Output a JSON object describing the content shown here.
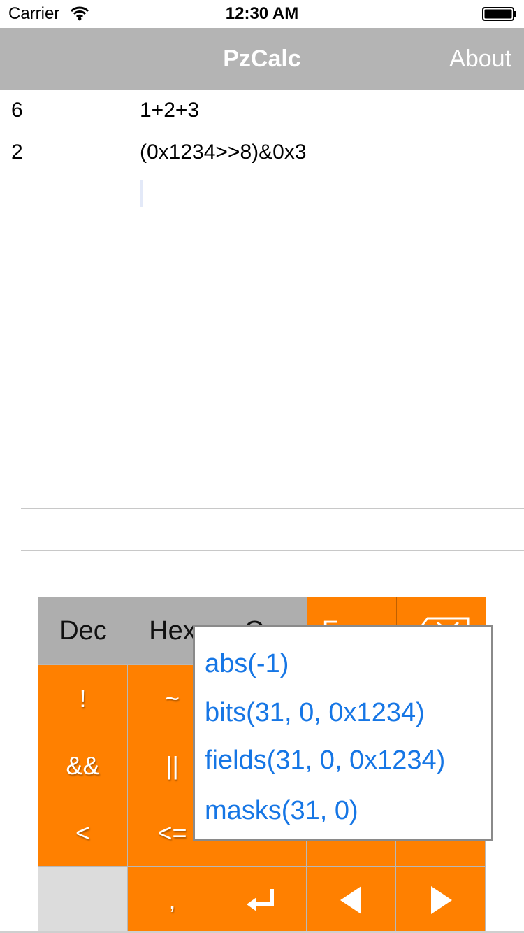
{
  "status_bar": {
    "carrier": "Carrier",
    "time": "12:30 AM"
  },
  "nav": {
    "title": "PzCalc",
    "about_label": "About"
  },
  "rows": [
    {
      "result": "6",
      "expression": "1+2+3"
    },
    {
      "result": "2",
      "expression": "(0x1234>>8)&0x3"
    }
  ],
  "keypad": {
    "tabs": [
      {
        "label": "Dec",
        "active": false
      },
      {
        "label": "Hex",
        "active": false
      },
      {
        "label": "Op",
        "active": false
      },
      {
        "label": "Func",
        "active": true
      },
      {
        "label": "",
        "icon": "backspace-icon"
      }
    ],
    "keys": {
      "row1": [
        "!",
        "~"
      ],
      "row2": [
        "&&",
        "||"
      ],
      "row3": [
        "<",
        "<="
      ],
      "row4": [
        ",",
        "return-icon",
        "left-arrow-icon",
        "right-arrow-icon"
      ]
    },
    "active_color": "#ff8000",
    "inactive_color": "#aeaeae"
  },
  "function_popup": {
    "items": [
      "abs(-1)",
      "bits(31, 0, 0x1234)",
      "fields(31, 0, 0x1234)",
      "masks(31, 0)"
    ],
    "text_color": "#1676e5"
  }
}
